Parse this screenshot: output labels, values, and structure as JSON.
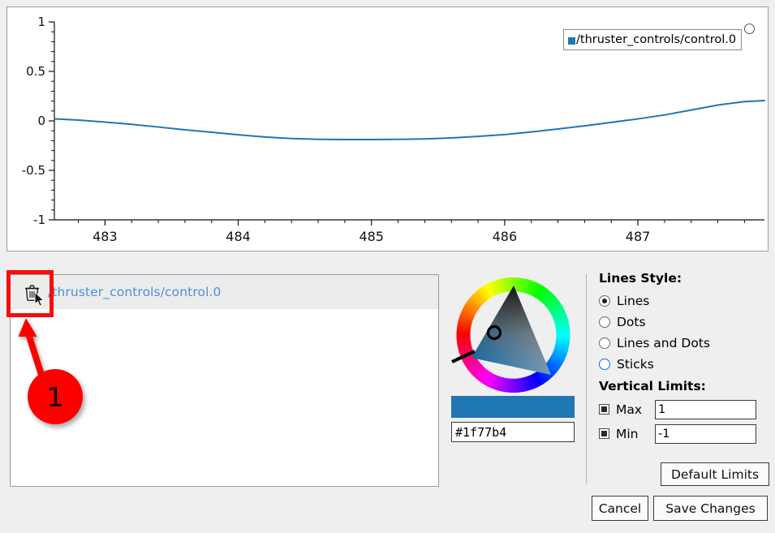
{
  "chart_data": {
    "type": "line",
    "title": "",
    "xlabel": "",
    "ylabel": "",
    "xlim": [
      482.62,
      487.95
    ],
    "ylim": [
      -1,
      1
    ],
    "grid": false,
    "legend_position": "top-right",
    "x_ticks": [
      "483",
      "484",
      "485",
      "486",
      "487"
    ],
    "x_tick_values": [
      483,
      484,
      485,
      486,
      487
    ],
    "y_ticks": [
      "1",
      "0.5",
      "0",
      "-0.5",
      "-1"
    ],
    "y_tick_values": [
      1,
      0.5,
      0,
      -0.5,
      -1
    ],
    "minor_tick_step_x": 0.2,
    "minor_tick_step_y": 0.1,
    "series": [
      {
        "name": "/thruster_controls/control.0",
        "color": "#1f77b4",
        "x": [
          482.62,
          482.8,
          483.0,
          483.2,
          483.4,
          483.6,
          483.8,
          484.0,
          484.2,
          484.4,
          484.6,
          484.8,
          485.0,
          485.2,
          485.4,
          485.6,
          485.8,
          486.0,
          486.2,
          486.4,
          486.6,
          486.8,
          487.0,
          487.2,
          487.4,
          487.6,
          487.8,
          487.95
        ],
        "values": [
          0.02,
          0.008,
          -0.012,
          -0.035,
          -0.062,
          -0.09,
          -0.115,
          -0.14,
          -0.163,
          -0.178,
          -0.186,
          -0.189,
          -0.189,
          -0.187,
          -0.182,
          -0.172,
          -0.157,
          -0.138,
          -0.112,
          -0.082,
          -0.05,
          -0.015,
          0.02,
          0.06,
          0.11,
          0.16,
          0.195,
          0.205
        ]
      }
    ]
  },
  "chart": {
    "legend": {
      "label": "/thruster_controls/control.0",
      "swatch_color": "#1f77b4"
    }
  },
  "curve_list": {
    "items": [
      {
        "name": "/thruster_controls/control.0",
        "delete_icon": "trash-icon",
        "text_color": "#4a90d9"
      }
    ]
  },
  "annotation": {
    "badge_number": "1",
    "highlight_color": "#fc0b0b",
    "badge_color": "#fc0000"
  },
  "color_picker": {
    "hex_value": "#1f77b4",
    "swatch_color": "#1f77b4",
    "wheel_icon": "color-wheel-icon"
  },
  "options": {
    "lines_style": {
      "title": "Lines Style:",
      "selected": "Lines",
      "choices": [
        {
          "label": "Lines",
          "checked": true,
          "focused": false
        },
        {
          "label": "Dots",
          "checked": false,
          "focused": false
        },
        {
          "label": "Lines and Dots",
          "checked": false,
          "focused": false
        },
        {
          "label": "Sticks",
          "checked": false,
          "focused": true
        }
      ]
    },
    "vertical_limits": {
      "title": "Vertical Limits:",
      "max": {
        "label": "Max",
        "value": "1",
        "checked": true
      },
      "min": {
        "label": "Min",
        "value": "-1",
        "checked": true
      },
      "default_button": "Default Limits"
    }
  },
  "footer": {
    "cancel_label": "Cancel",
    "save_label": "Save Changes"
  }
}
